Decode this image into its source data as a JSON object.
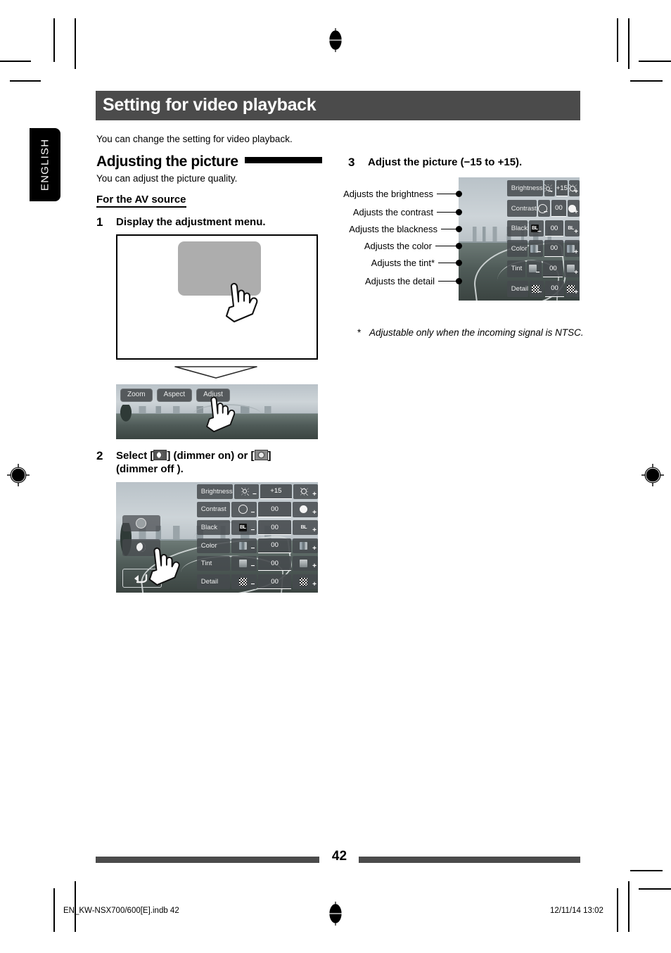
{
  "page": {
    "language_tab": "ENGLISH",
    "chapter_title": "Setting for video playback",
    "intro": "You can change the setting for video playback.",
    "page_number": "42",
    "colophon_left": "EN_KW-NSX700/600[E].indb   42",
    "colophon_right": "12/11/14   13:02",
    "accent_dark": "#4b4b4b",
    "ink": "#000000"
  },
  "section": {
    "heading": "Adjusting the picture",
    "lead": "You can adjust the picture quality.",
    "subheading": "For the AV source"
  },
  "steps": [
    {
      "num": "1",
      "text": "Display the adjustment menu."
    },
    {
      "num": "2",
      "text_part1": "Select [",
      "text_part2": "] (dimmer on) or [",
      "text_part3": "]",
      "text_part4": "(dimmer off )."
    },
    {
      "num": "3",
      "text": "Adjust the picture (−15 to +15)."
    }
  ],
  "video_controls": {
    "zoom": "Zoom",
    "aspect": "Aspect",
    "adjust": "Adjust"
  },
  "adjust_menu": {
    "rows": [
      {
        "label": "Brightness",
        "value": "+15",
        "minus_icon": "small-sun-icon",
        "plus_icon": "large-sun-icon"
      },
      {
        "label": "Contrast",
        "value": "00",
        "minus_icon": "circle-outline-icon",
        "plus_icon": "circle-filled-icon"
      },
      {
        "label": "Black",
        "value": "00",
        "minus_icon": "black-level-dark-icon",
        "plus_icon": "black-level-light-icon",
        "minus_text": "BL",
        "plus_text": "BL"
      },
      {
        "label": "Color",
        "value": "00",
        "minus_icon": "color-swatch-icon",
        "plus_icon": "color-swatch-icon"
      },
      {
        "label": "Tint",
        "value": "00",
        "minus_icon": "tint-swatch-icon",
        "plus_icon": "tint-swatch-icon"
      },
      {
        "label": "Detail",
        "value": "00",
        "minus_icon": "checker-icon",
        "plus_icon": "checker-icon"
      }
    ],
    "minus_sign": "−",
    "plus_sign": "+"
  },
  "callouts": [
    "Adjusts the brightness",
    "Adjusts the contrast",
    "Adjusts the blackness",
    "Adjusts the color",
    "Adjusts the tint*",
    "Adjusts the detail"
  ],
  "footnote": {
    "marker": "*",
    "text": "Adjustable only when the incoming signal is NTSC."
  }
}
